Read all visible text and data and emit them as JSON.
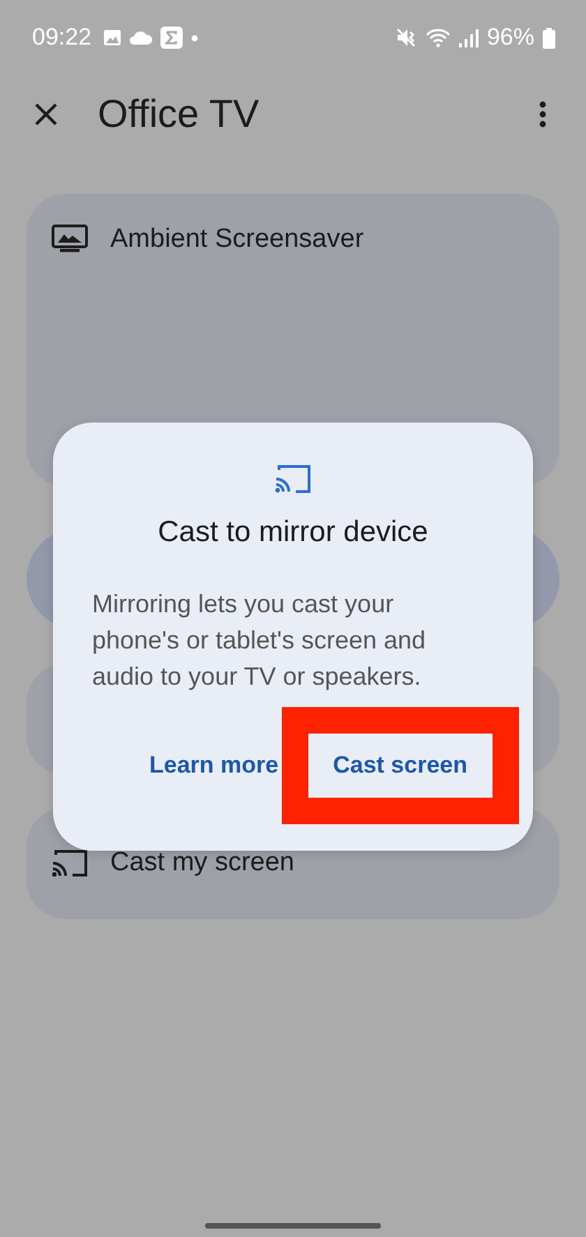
{
  "status_bar": {
    "time": "09:22",
    "battery": "96%"
  },
  "app_bar": {
    "title": "Office TV"
  },
  "cards": [
    {
      "kind": "screensaver",
      "label": "Ambient Screensaver"
    },
    {
      "kind": "cast",
      "label": "Cast my screen"
    }
  ],
  "dialog": {
    "title": "Cast to mirror device",
    "body": "Mirroring lets you cast your phone's or tablet's screen and audio to your TV or speakers.",
    "buttons": [
      {
        "label": "Learn more",
        "highlighted": false
      },
      {
        "label": "Cast screen",
        "highlighted": true
      }
    ]
  }
}
